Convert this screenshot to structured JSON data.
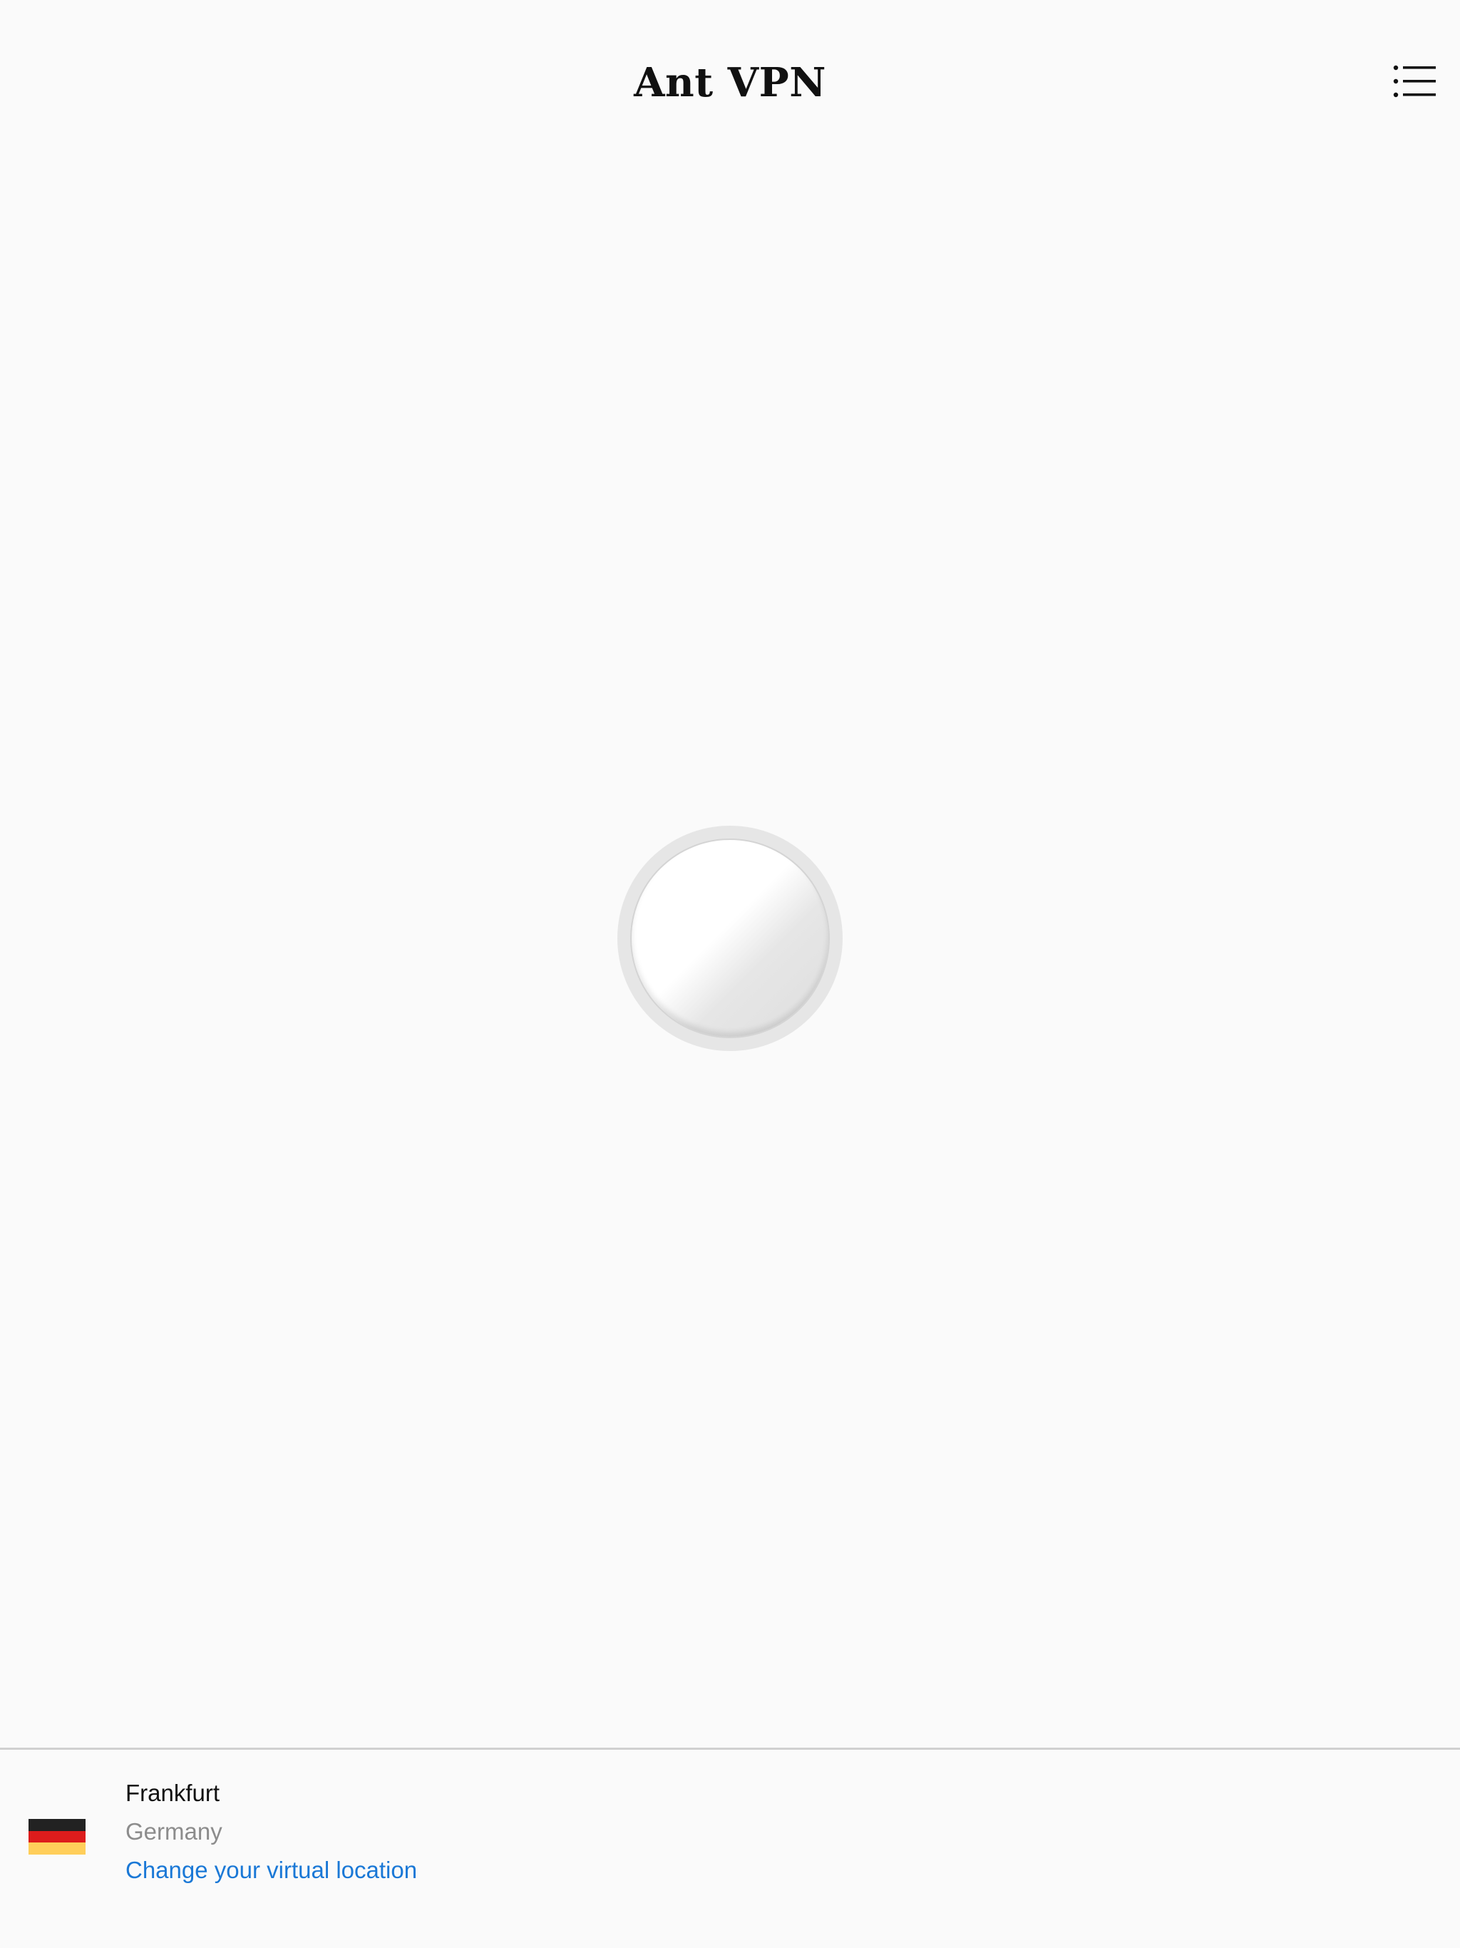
{
  "header": {
    "title": "Ant VPN",
    "menu_icon": "list-menu-icon"
  },
  "connect_button": {
    "icon": "power-toggle-circle"
  },
  "location": {
    "city": "Frankfurt",
    "country": "Germany",
    "change_link": "Change your virtual location",
    "flag": {
      "name": "germany-flag-icon",
      "colors": [
        "#222222",
        "#dd1c1c",
        "#ffce5a"
      ]
    }
  },
  "colors": {
    "background": "#fafafa",
    "link": "#1a78d6",
    "secondary_text": "#8c8c8c",
    "divider": "#d0d0d0"
  }
}
